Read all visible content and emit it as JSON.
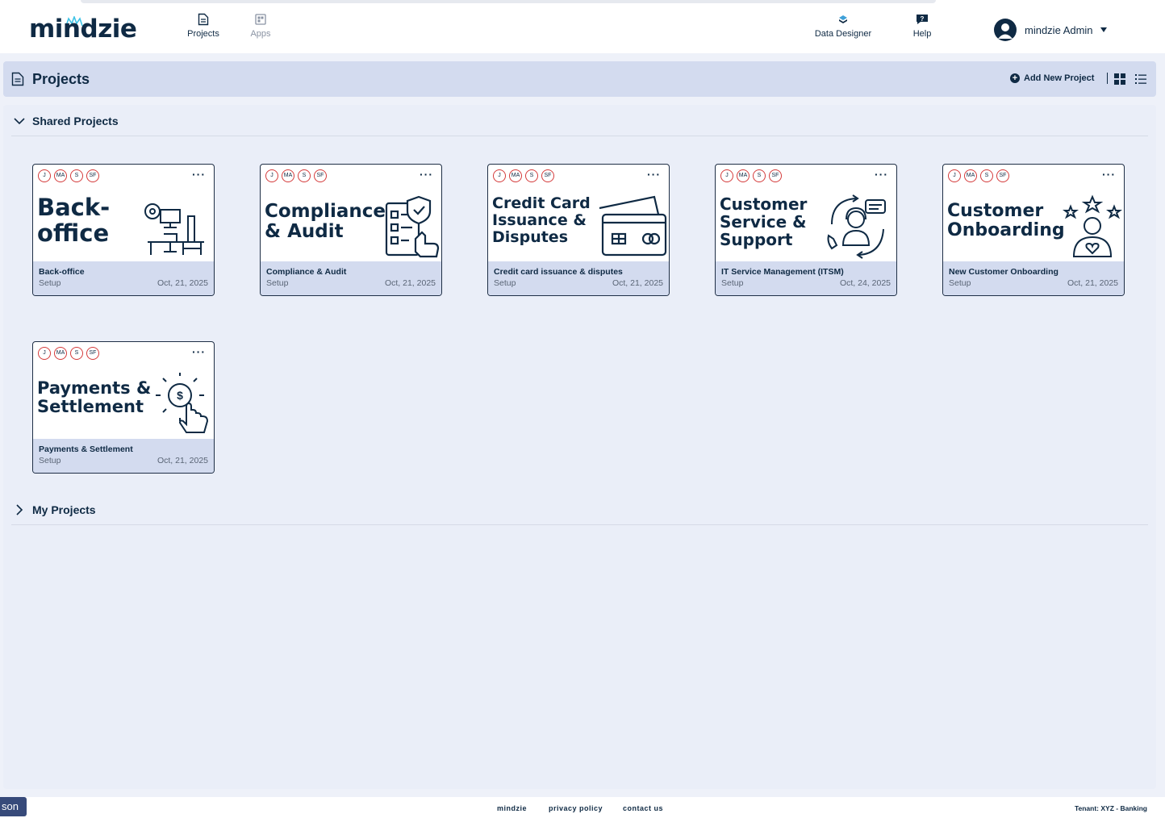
{
  "app": {
    "logo_text": "mindzie"
  },
  "nav": {
    "projects_label": "Projects",
    "apps_label": "Apps",
    "data_designer_label": "Data Designer",
    "help_label": "Help",
    "user_name": "mindzie Admin"
  },
  "page": {
    "title": "Projects",
    "add_label": "Add New Project"
  },
  "sections": {
    "shared_title": "Shared Projects",
    "my_title": "My Projects"
  },
  "badges": [
    "J",
    "MA",
    "S",
    "SF"
  ],
  "cards": [
    {
      "art_title": "Back-\noffice",
      "name": "Back-office",
      "status": "Setup",
      "date": "Oct, 21, 2025",
      "icon": "workstation-icon"
    },
    {
      "art_title": "Compliance\n& Audit",
      "name": "Compliance & Audit",
      "status": "Setup",
      "date": "Oct, 21, 2025",
      "icon": "checklist-shield-icon"
    },
    {
      "art_title": "Credit Card\nIssuance &\nDisputes",
      "name": "Credit card issuance & disputes",
      "status": "Setup",
      "date": "Oct, 21, 2025",
      "icon": "credit-card-icon"
    },
    {
      "art_title": "Customer\nService &\nSupport",
      "name": "IT Service Management (ITSM)",
      "status": "Setup",
      "date": "Oct, 24, 2025",
      "icon": "support-agent-icon"
    },
    {
      "art_title": "Customer\nOnboarding",
      "name": "New Customer Onboarding",
      "status": "Setup",
      "date": "Oct, 21, 2025",
      "icon": "user-stars-icon"
    },
    {
      "art_title": "Payments &\nSettlement",
      "name": "Payments & Settlement",
      "status": "Setup",
      "date": "Oct, 21, 2025",
      "icon": "payment-click-icon"
    }
  ],
  "footer": {
    "link1": "mindzie",
    "link2": "privacy policy",
    "link3": "contact us",
    "tenant": "Tenant: XYZ - Banking",
    "chip": "son"
  },
  "colors": {
    "navy": "#0f2a44",
    "header_bg": "#d3dbef",
    "badge_ring": "#d43b3b",
    "page_bg": "#eef1f9"
  }
}
